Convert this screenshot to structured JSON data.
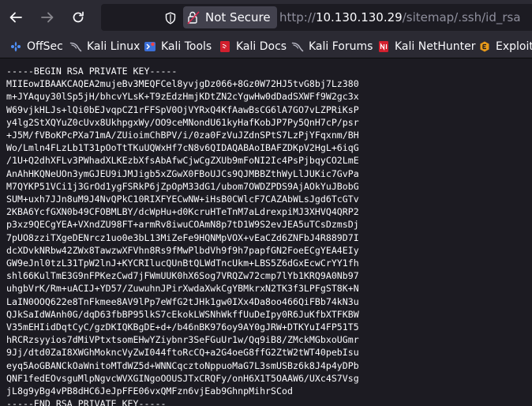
{
  "browser": {
    "security_label": "Not Secure",
    "url_prefix": "http://",
    "url_host": "10.130.130.29",
    "url_path": "/sitemap/.ssh/id_rsa",
    "icons": {
      "back": "arrow-left-icon",
      "forward": "arrow-right-icon",
      "reload": "reload-icon",
      "shield": "shield-icon",
      "lock": "lock-warning-icon"
    }
  },
  "bookmarks": [
    {
      "label": "OffSec",
      "icon": "offsec-icon",
      "color": "#3b82f6"
    },
    {
      "label": "Kali Linux",
      "icon": "kali-dragon-icon",
      "color": "#9ca3af"
    },
    {
      "label": "Kali Tools",
      "icon": "kali-tools-icon",
      "color": "#ef4444"
    },
    {
      "label": "Kali Docs",
      "icon": "kali-docs-icon",
      "color": "#dc2626"
    },
    {
      "label": "Kali Forums",
      "icon": "kali-forums-icon",
      "color": "#9ca3af"
    },
    {
      "label": "Kali NetHunter",
      "icon": "kali-nethunter-icon",
      "color": "#dc2626"
    },
    {
      "label": "Exploit-",
      "icon": "exploit-db-icon",
      "color": "#f59e0b"
    }
  ],
  "content": {
    "key_lines": [
      "-----BEGIN RSA PRIVATE KEY-----",
      "MIIEowIBAAKCAQEA2mujeBv3MEQFCel8yvjgDz066+8Gz0W72HJ5tvG8bj7Lz380",
      "m+JYAquy30lSp5jH/bhcvYLsK+T9zEdzHmjKDtZN2cYgwHw0dDadSXWFf9W2gc3x",
      "W69vjkHLJs+lQi0bEJvqpCZ1rFFSpV0OjVYRxQ4KfAawBsCG6lA7GO7vLZPRiKsP",
      "y4lg2StXQYuZ0cUvx8UkhpgxWy/OO9ceMNondU61kyHafKobJP7Py5QnH7cP/psr",
      "+J5M/fVBoKPcPXa71mA/ZUioimChBPV/i/0za0FzVuJZdnSPtS7LzPjYFqxnm/BH",
      "Wo/Lmln4FLzLb1T31pOoTtTKuUQWxHf7cN8v6QIDAQABAoIBAFZDKpV2HgL+6iqG",
      "/1U+Q2dhXFLv3PWhadXLKEzbXfsAbAfwCjwCgZXUb9mFoNI2Ic4PsPjbqyCO2LmE",
      "AnAhHKQNeUOn3ymGJEU9iJMJigb5xZGwX0FBoUJCs9QJMBBZthWyLlJUKic7GvPa",
      "M7QYKP51VCi1j3GrOd1ygFSRkP6jZpOpM33dG1/ubom7OWDZPDS9AjAOkYuJBobG",
      "SUM+uxh7JJn8uM9J4NvQPkC10RIXFYECwNW+iHsB0CWlcF7CAZAbWLsJgd6TcGTv",
      "2KBA6YcfGXN0b49CFOBMLBY/dcWpHu+d0KcruHTeTnM7aLdrexpiMJ3XHVQ4QRP2",
      "p3xz9QECgYEA+VXndZU98FT+armRv8iwuCOAmN8p7tD1W9S2evJEA5uTCsDzmsDj",
      "7pUO8zziTXgeDENrcz1uo0e3bL13MiZeFe9HQNMpVOX+vEaCZd6ZNFbJ4R889D7I",
      "dcXDvkNRbw42ZWx8TawzwXFVhn8Rs9fMwPlbdVh9f9h7papfGN2FoeECgYEA4EIy",
      "GW9eJnl0tzL31TpW2lnJ+KYCRIlucQUnBtQLWdTncUkm+LBS5Z6dGxEcwCrYY1fh",
      "shl66KulTmE3G9nFPKezCwd7jFWmUUK0hX6Sog7VRQZw72cmp7lYb1KRQ9A0Nb97",
      "uhgbVrK/Rm+uACIJ+YD57/ZuwuhnJPirXwdaXwkCgYBMkrxN2TK3f3LPFgST8K+N",
      "LaIN0OOQ622e8TnFkmee8AV9lPp7eWfG2tJHk1gw0IXx4Da8oo466QiFBb74kN3u",
      "QJkSaIdWAnh0G/dqD63fbBP95lkS7cEkokLWSNhWkffUuDeIpy0R6JuKfbXTFKBW",
      "V35mEHIidDqtCyC/gzDKIQKBgDE+d+/b46nBK976oy9AY0gJRW+DTKYuI4FP51T5",
      "hRCRzsyyios7dMiVPtxtsomEHwYZiybnr3SeFGuUr1w/Qq9iB8/ZMckMGbxoUGmr",
      "9Jj/dtd0ZaI8XWGhMokncVyZwI044ftoRcCQ+a2G4oeG8ffG2ZtW2tWT40pebIsu",
      "eyq5AoGBANCkOaWnitoMTdWZ5d+WNNCqcztoNppuoMaG7L3smUSBz6k8J4p4yDPb",
      "QNF1fedEOvsguMlpNgvcWVXGINgoOOUSJTxCRQFy/onH6X1T5OAAW6/UXc4S7Vsg",
      "jL8g9yBg4vPB8dHC6JeJpFFE06vxQMFzn6vjEab9GhnpMihrSCod",
      "-----END RSA PRIVATE KEY-----"
    ]
  },
  "colors": {
    "toolbar_bg": "#2b2a33",
    "page_bg": "#1c1b22",
    "text": "#fbfbfe",
    "url_dim": "#8f8f9d"
  }
}
